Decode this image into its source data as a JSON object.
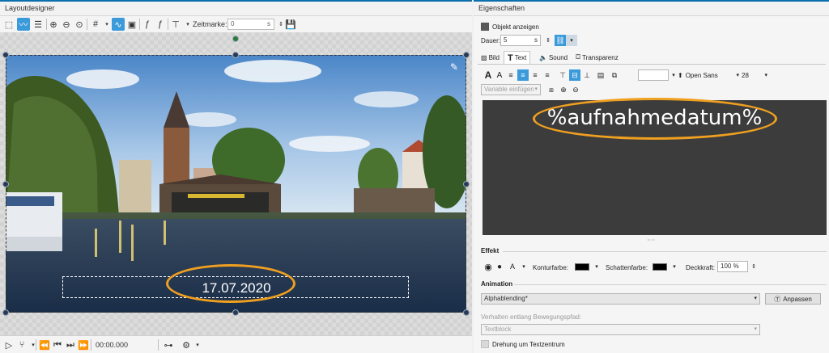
{
  "left_panel": {
    "title": "Layoutdesigner",
    "toolbar": {
      "zeitmarke_label": "Zeitmarke:",
      "zeitmarke_value": "0",
      "zeitmarke_unit": "s"
    },
    "date_text": "17.07.2020",
    "timecode": "00:00.000"
  },
  "right_panel": {
    "title": "Eigenschaften",
    "show_object_label": "Objekt anzeigen",
    "duration_label": "Dauer:",
    "duration_value": "5",
    "duration_unit": "s",
    "tabs": [
      {
        "label": "Bild"
      },
      {
        "label": "Text"
      },
      {
        "label": "Sound"
      },
      {
        "label": "Transparenz"
      }
    ],
    "font_name": "Open Sans",
    "font_size": "28",
    "insert_variable": "Variable einfügen",
    "editor_text": "%aufnahmedatum%",
    "effect": {
      "section_label": "Effekt",
      "outline_color_label": "Konturfarbe:",
      "shadow_color_label": "Schattenfarbe:",
      "opacity_label": "Deckkraft:",
      "opacity_value": "100 %"
    },
    "animation": {
      "section_label": "Animation",
      "selected": "Alphablending*",
      "customize_button": "Anpassen",
      "path_behavior_label": "Verhalten entlang Bewegungspfad:",
      "path_behavior_value": "Textblock",
      "rotate_label": "Drehung um Textzentrum"
    }
  },
  "colors": {
    "accent": "#0c6fae",
    "highlight": "#f0a020",
    "active_button": "#3b9ad9",
    "editor_bg": "#3c3c3c"
  }
}
